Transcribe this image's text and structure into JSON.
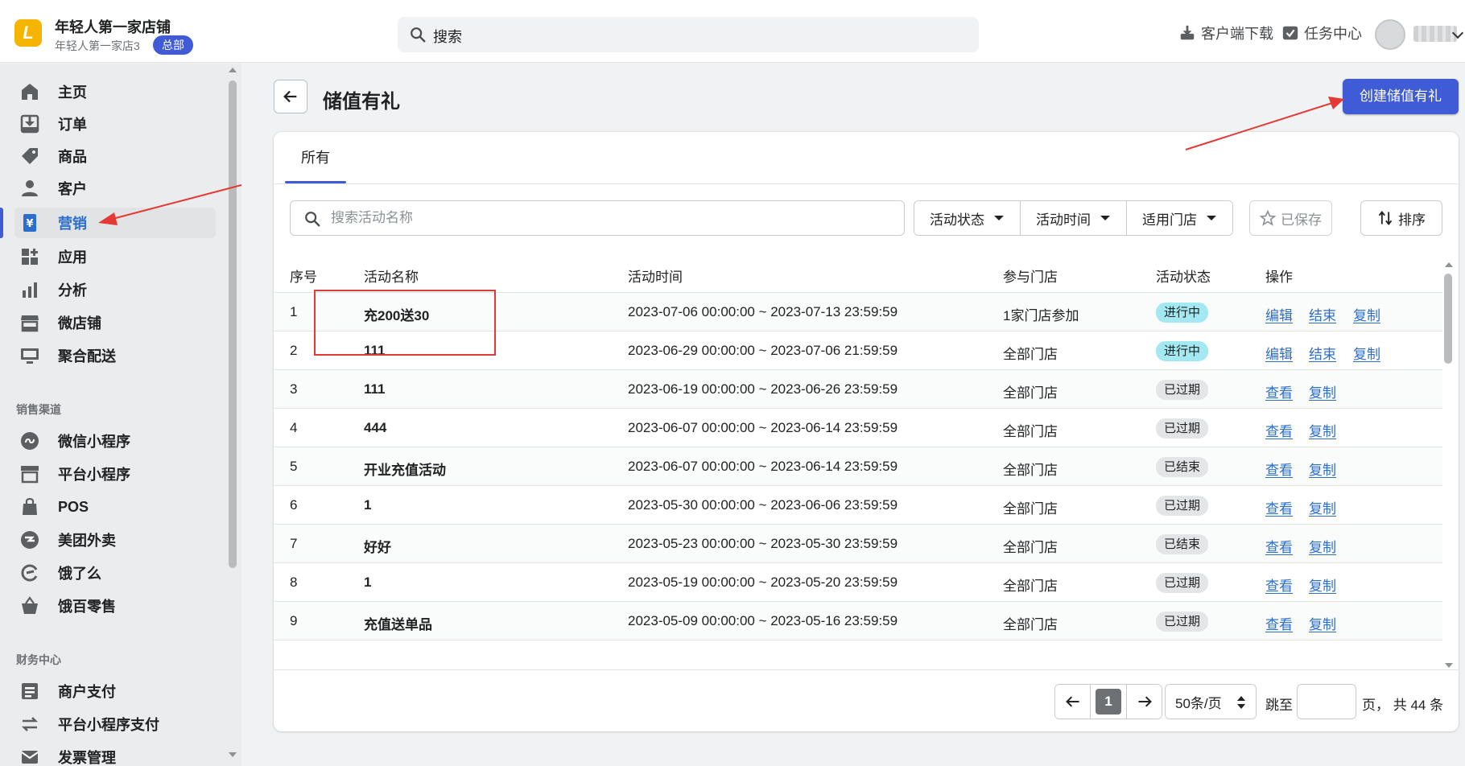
{
  "header": {
    "logo_letter": "L",
    "shop_name": "年轻人第一家店铺",
    "shop_sub": "年轻人第一家店3",
    "hq_badge": "总部",
    "search_text": "搜索",
    "download_label": "客户端下载",
    "task_label": "任务中心"
  },
  "sidebar": {
    "items": [
      {
        "label": "主页",
        "icon": "home-icon"
      },
      {
        "label": "订单",
        "icon": "order-icon"
      },
      {
        "label": "商品",
        "icon": "tag-icon"
      },
      {
        "label": "客户",
        "icon": "customer-icon"
      },
      {
        "label": "营销",
        "icon": "marketing-icon",
        "active": true
      },
      {
        "label": "应用",
        "icon": "apps-icon"
      },
      {
        "label": "分析",
        "icon": "analytics-icon"
      },
      {
        "label": "微店铺",
        "icon": "store-icon"
      },
      {
        "label": "聚合配送",
        "icon": "delivery-icon"
      }
    ],
    "channels_title": "销售渠道",
    "channels": [
      {
        "label": "微信小程序",
        "icon": "wechat-miniapp-icon"
      },
      {
        "label": "平台小程序",
        "icon": "platform-miniapp-icon"
      },
      {
        "label": "POS",
        "icon": "pos-icon"
      },
      {
        "label": "美团外卖",
        "icon": "meituan-icon"
      },
      {
        "label": "饿了么",
        "icon": "eleme-icon"
      },
      {
        "label": "饿百零售",
        "icon": "basket-icon"
      }
    ],
    "finance_title": "财务中心",
    "finance": [
      {
        "label": "商户支付",
        "icon": "merchant-pay-icon"
      },
      {
        "label": "平台小程序支付",
        "icon": "transfer-icon"
      },
      {
        "label": "发票管理",
        "icon": "invoice-icon"
      }
    ]
  },
  "page": {
    "title": "储值有礼",
    "create_button": "创建储值有礼",
    "tab_all": "所有",
    "search_placeholder": "搜索活动名称",
    "filters": [
      "活动状态",
      "活动时间",
      "适用门店"
    ],
    "saved_label": "已保存",
    "sort_label": "排序"
  },
  "table": {
    "headers": {
      "no": "序号",
      "name": "活动名称",
      "time": "活动时间",
      "store": "参与门店",
      "status": "活动状态",
      "ops": "操作"
    },
    "rows": [
      {
        "no": "1",
        "name": "充200送30",
        "time": "2023-07-06 00:00:00 ~ 2023-07-13 23:59:59",
        "store": "1家门店参加",
        "status": "进行中",
        "status_type": "active",
        "ops": [
          "编辑",
          "结束",
          "复制"
        ]
      },
      {
        "no": "2",
        "name": "111",
        "time": "2023-06-29 00:00:00 ~ 2023-07-06 21:59:59",
        "store": "全部门店",
        "status": "进行中",
        "status_type": "active",
        "ops": [
          "编辑",
          "结束",
          "复制"
        ]
      },
      {
        "no": "3",
        "name": "111",
        "time": "2023-06-19 00:00:00 ~ 2023-06-26 23:59:59",
        "store": "全部门店",
        "status": "已过期",
        "status_type": "grey",
        "ops": [
          "查看",
          "复制"
        ]
      },
      {
        "no": "4",
        "name": "444",
        "time": "2023-06-07 00:00:00 ~ 2023-06-14 23:59:59",
        "store": "全部门店",
        "status": "已过期",
        "status_type": "grey",
        "ops": [
          "查看",
          "复制"
        ]
      },
      {
        "no": "5",
        "name": "开业充值活动",
        "time": "2023-06-07 00:00:00 ~ 2023-06-14 23:59:59",
        "store": "全部门店",
        "status": "已结束",
        "status_type": "grey",
        "ops": [
          "查看",
          "复制"
        ]
      },
      {
        "no": "6",
        "name": "1",
        "time": "2023-05-30 00:00:00 ~ 2023-06-06 23:59:59",
        "store": "全部门店",
        "status": "已过期",
        "status_type": "grey",
        "ops": [
          "查看",
          "复制"
        ]
      },
      {
        "no": "7",
        "name": "好好",
        "time": "2023-05-23 00:00:00 ~ 2023-05-30 23:59:59",
        "store": "全部门店",
        "status": "已结束",
        "status_type": "grey",
        "ops": [
          "查看",
          "复制"
        ]
      },
      {
        "no": "8",
        "name": "1",
        "time": "2023-05-19 00:00:00 ~ 2023-05-20 23:59:59",
        "store": "全部门店",
        "status": "已过期",
        "status_type": "grey",
        "ops": [
          "查看",
          "复制"
        ]
      },
      {
        "no": "9",
        "name": "充值送单品",
        "time": "2023-05-09 00:00:00 ~ 2023-05-16 23:59:59",
        "store": "全部门店",
        "status": "已过期",
        "status_type": "grey",
        "ops": [
          "查看",
          "复制"
        ]
      }
    ]
  },
  "pagination": {
    "current_page": "1",
    "per_page": "50条/页",
    "jump_label": "跳至",
    "total_label": "页， 共 44 条"
  },
  "colors": {
    "accent": "#3f5bd6",
    "link": "#2c6ecb",
    "annotation": "#e53935"
  }
}
